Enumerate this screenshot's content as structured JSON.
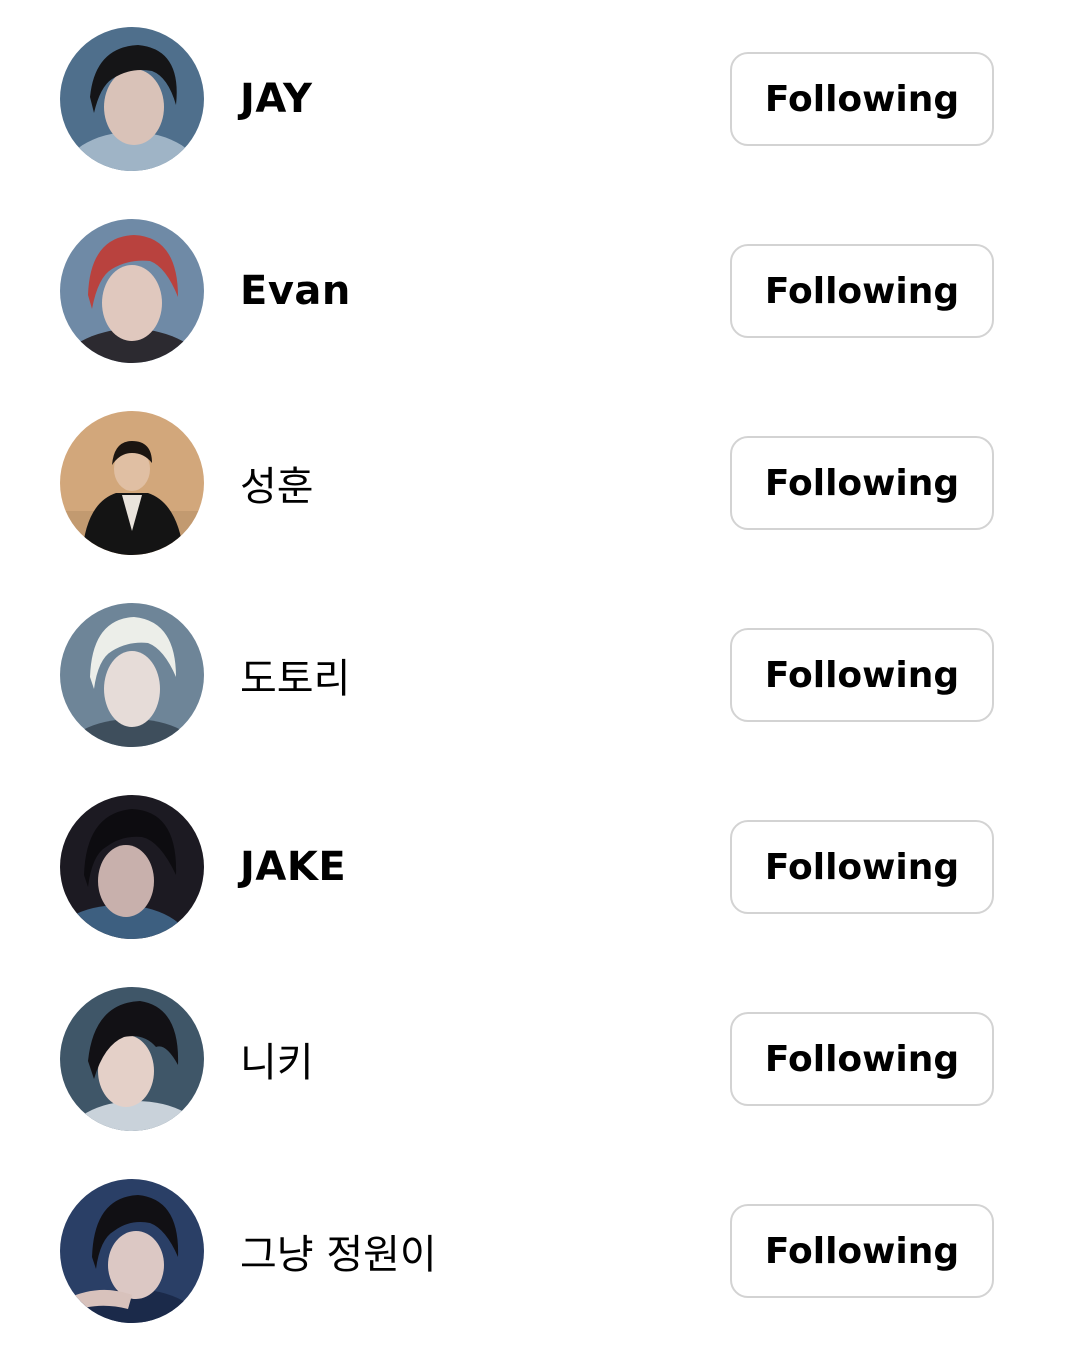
{
  "following_list": {
    "items": [
      {
        "name": "JAY",
        "button_label": "Following",
        "script": "latin"
      },
      {
        "name": "Evan",
        "button_label": "Following",
        "script": "latin"
      },
      {
        "name": "성훈",
        "button_label": "Following",
        "script": "hangul"
      },
      {
        "name": "도토리",
        "button_label": "Following",
        "script": "hangul"
      },
      {
        "name": "JAKE",
        "button_label": "Following",
        "script": "latin"
      },
      {
        "name": "니키",
        "button_label": "Following",
        "script": "hangul"
      },
      {
        "name": "그냥 정원이",
        "button_label": "Following",
        "script": "hangul"
      }
    ]
  },
  "colors": {
    "background": "#ffffff",
    "text": "#000000",
    "button_border": "#d3d3d3"
  }
}
